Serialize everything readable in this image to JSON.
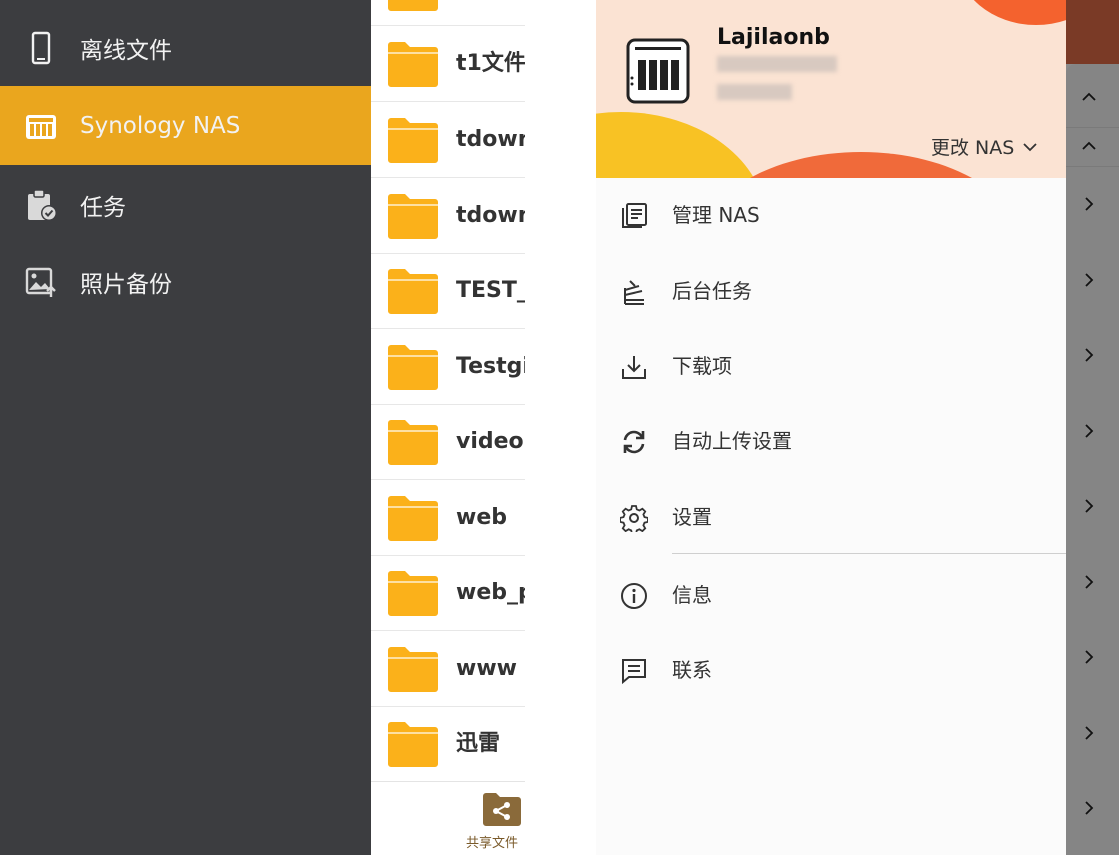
{
  "sidebar": {
    "items": [
      {
        "label": "离线文件",
        "icon": "phone-icon"
      },
      {
        "label": "Synology NAS",
        "icon": "nas-drive-icon",
        "active": true
      },
      {
        "label": "任务",
        "icon": "clipboard-check-icon"
      },
      {
        "label": "照片备份",
        "icon": "photo-upload-icon"
      }
    ]
  },
  "file_list": {
    "items": [
      {
        "name": "t1文件"
      },
      {
        "name": "tdownl"
      },
      {
        "name": "tdownl"
      },
      {
        "name": "TEST_("
      },
      {
        "name": "Testgit"
      },
      {
        "name": "video"
      },
      {
        "name": "web"
      },
      {
        "name": "web_p"
      },
      {
        "name": "www"
      },
      {
        "name": "迅雷"
      }
    ],
    "bottom_tab_label": "共享文件"
  },
  "drawer": {
    "nas_name": "Lajilaonb",
    "change_nas_label": "更改 NAS",
    "menu": [
      {
        "label": "管理 NAS",
        "icon": "manage-list-icon"
      },
      {
        "label": "后台任务",
        "icon": "background-tasks-icon"
      },
      {
        "label": "下载项",
        "icon": "download-icon"
      },
      {
        "label": "自动上传设置",
        "icon": "sync-icon"
      },
      {
        "label": "设置",
        "icon": "gear-icon"
      },
      {
        "label": "信息",
        "icon": "info-icon"
      },
      {
        "label": "联系",
        "icon": "message-icon"
      }
    ]
  },
  "colors": {
    "sidebar_bg": "#3c3d40",
    "accent": "#eaa61e",
    "folder": "#fbb11a",
    "header_bg": "#fbe3d3"
  }
}
